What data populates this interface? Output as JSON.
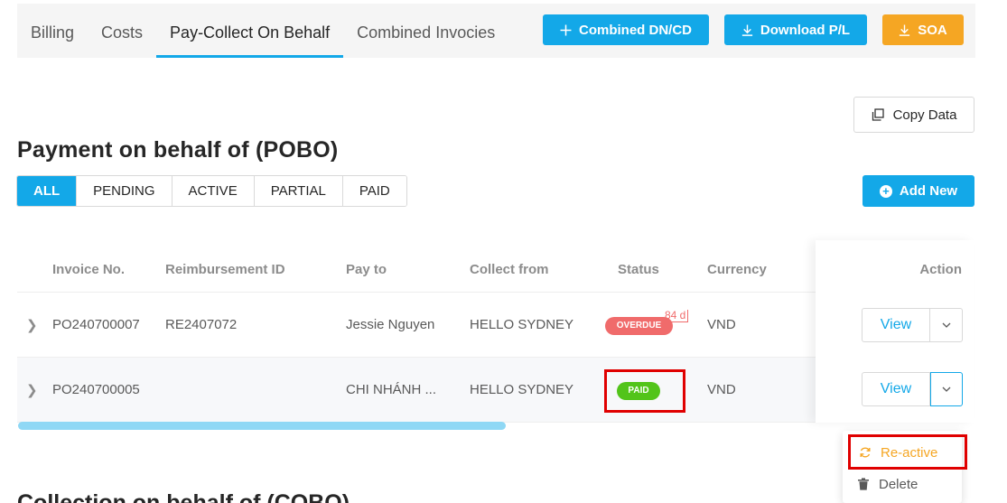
{
  "tabs": [
    "Billing",
    "Costs",
    "Pay-Collect On Behalf",
    "Combined Invocies"
  ],
  "active_tab": "Pay-Collect On Behalf",
  "toolbar": {
    "combined_label": "Combined DN/CD",
    "download_label": "Download P/L",
    "soa_label": "SOA",
    "copy_label": "Copy Data",
    "add_label": "Add New"
  },
  "section": {
    "title": "Payment on behalf of (POBO)",
    "next_title": "Collection on behalf of (COBO)"
  },
  "filters": [
    "ALL",
    "PENDING",
    "ACTIVE",
    "PARTIAL",
    "PAID"
  ],
  "active_filter": "ALL",
  "table": {
    "headers": {
      "invoice": "Invoice No.",
      "reimbursement": "Reimbursement ID",
      "pay_to": "Pay to",
      "collect_from": "Collect from",
      "status": "Status",
      "currency": "Currency",
      "action": "Action"
    },
    "rows": [
      {
        "invoice": "PO240700007",
        "reimbursement": "RE2407072",
        "pay_to": "Jessie Nguyen",
        "collect_from": "HELLO SYDNEY",
        "status": "OVERDUE",
        "overdue_days": "84 d",
        "currency": "VND",
        "view_label": "View"
      },
      {
        "invoice": "PO240700005",
        "reimbursement": "",
        "pay_to": "CHI NHÁNH ...",
        "collect_from": "HELLO SYDNEY",
        "status": "PAID",
        "currency": "VND",
        "view_label": "View"
      }
    ]
  },
  "menu": {
    "reactive_label": "Re-active",
    "delete_label": "Delete"
  },
  "colors": {
    "primary": "#13a8e8",
    "orange": "#f5a623",
    "overdue": "#f06b6b",
    "paid": "#52c41a",
    "highlight": "#e00000"
  }
}
